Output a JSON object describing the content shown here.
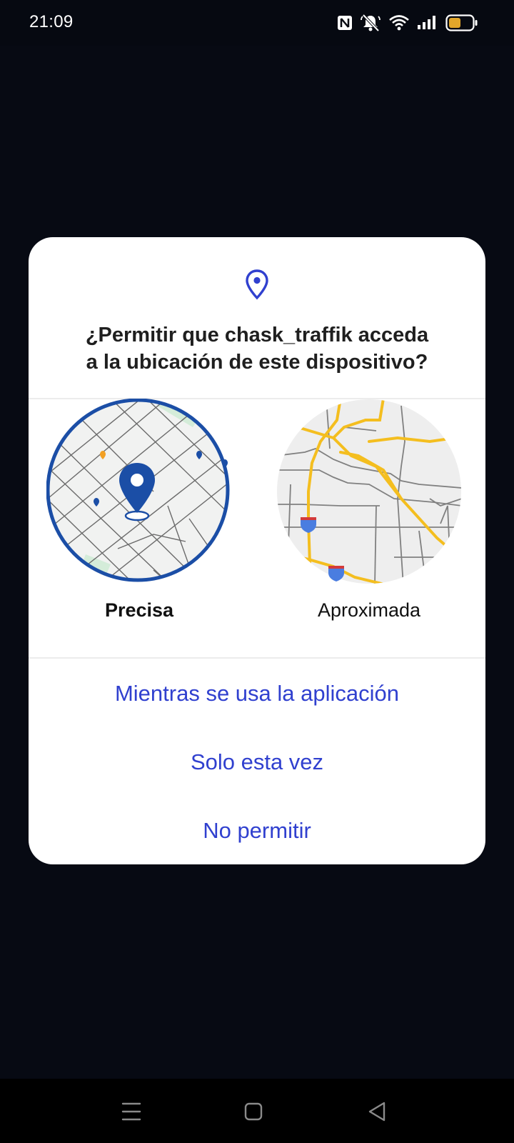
{
  "status_bar": {
    "time": "21:09",
    "icons": [
      "nfc-icon",
      "mute-icon",
      "wifi-icon",
      "signal-icon",
      "battery-icon"
    ],
    "battery_color": "#e2a62a"
  },
  "dialog": {
    "icon": "location-pin-icon",
    "title_line1": "¿Permitir que chask_traffik acceda",
    "title_line2": "a la ubicación de este dispositivo?",
    "options": [
      {
        "label": "Precisa",
        "selected": true
      },
      {
        "label": "Aproximada",
        "selected": false
      }
    ],
    "actions": [
      {
        "label": "Mientras se usa la aplicación"
      },
      {
        "label": "Solo esta vez"
      },
      {
        "label": "No permitir"
      }
    ],
    "accent_color": "#3040cf",
    "precise_ring_color": "#1b4ea6",
    "road_color": "#f4be1f"
  },
  "nav_bar": {
    "items": [
      "menu-icon",
      "home-icon",
      "back-icon"
    ]
  }
}
